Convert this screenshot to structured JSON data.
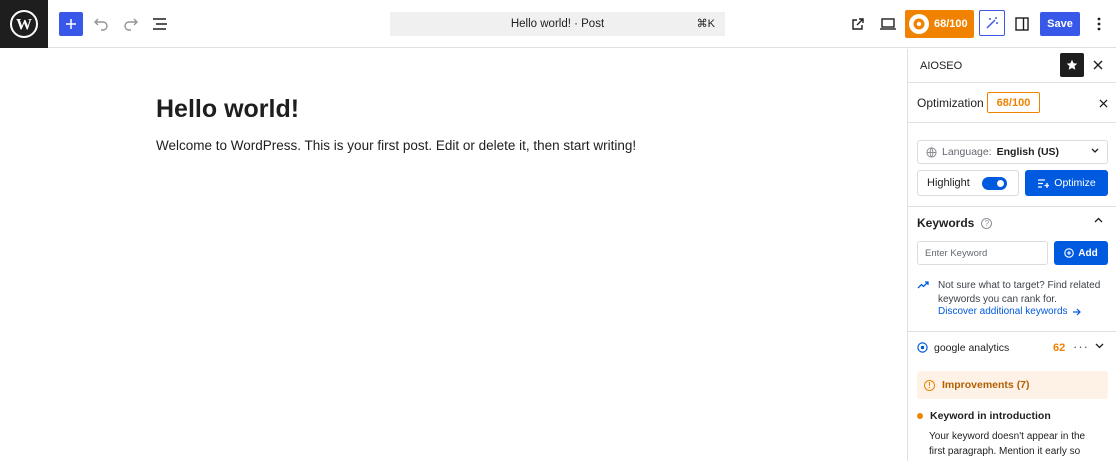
{
  "toolbar": {
    "command_title": "Hello world! · Post",
    "command_shortcut": "⌘K",
    "seo_score": "68/100",
    "save_label": "Save"
  },
  "post": {
    "title": "Hello world!",
    "body": "Welcome to WordPress. This is your first post. Edit or delete it, then start writing!"
  },
  "sidebar": {
    "title": "AIOSEO",
    "optimization_label": "Optimization",
    "optimization_score": "68/100",
    "language_label": "Language:",
    "language_value": "English (US)",
    "highlight_label": "Highlight",
    "highlight_on": true,
    "optimize_label": "Optimize",
    "keywords_heading": "Keywords",
    "keyword_placeholder": "Enter Keyword",
    "add_label": "Add",
    "tip_text": "Not sure what to target? Find related keywords you can rank for.",
    "tip_link": "Discover additional keywords",
    "keyword": {
      "name": "google analytics",
      "score": "62"
    },
    "improvements_label": "Improvements (7)",
    "check": {
      "title": "Keyword in introduction",
      "description": "Your keyword doesn't appear in the first paragraph. Mention it early so"
    }
  },
  "colors": {
    "accent_blue": "#3858e9",
    "aioseo_blue": "#005ae0",
    "score_orange": "#f18200",
    "dark": "#1e1e1e"
  },
  "icons": [
    "wordpress-logo-icon",
    "plus-icon",
    "undo-icon",
    "redo-icon",
    "list-view-icon",
    "external-link-icon",
    "desktop-preview-icon",
    "aioseo-score-icon",
    "magic-wand-icon",
    "sidebar-toggle-icon",
    "more-options-icon",
    "star-icon",
    "close-icon",
    "globe-icon",
    "chevron-down-icon",
    "optimize-icon",
    "help-icon",
    "chevron-up-icon",
    "plus-circle-icon",
    "trending-icon",
    "arrow-right-icon",
    "target-icon",
    "dots-icon",
    "warning-icon"
  ]
}
